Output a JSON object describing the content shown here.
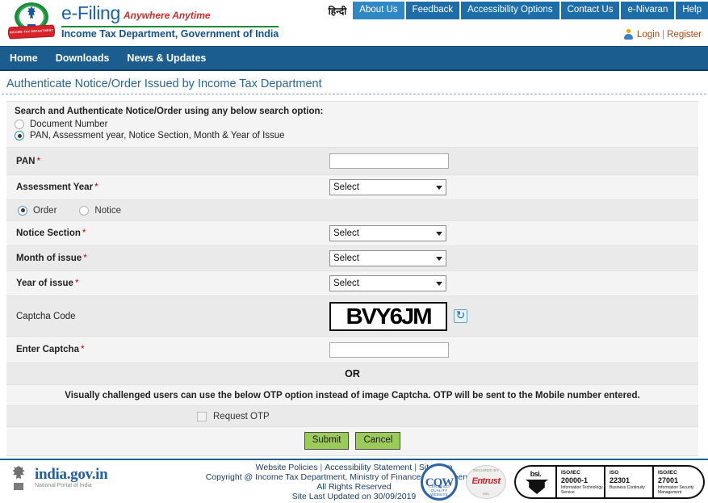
{
  "header": {
    "logo_alt": "income-tax-department-emblem",
    "emblem_ribbon": "INCOME TAX DEPARTMENT",
    "brand_main": "e-Filing",
    "brand_tagline": "Anywhere Anytime",
    "brand_sub": "Income Tax Department, Government of India",
    "hindi_label": "हिन्दी",
    "top_nav": [
      {
        "label": "About Us",
        "active": true
      },
      {
        "label": "Feedback",
        "active": false
      },
      {
        "label": "Accessibility Options",
        "active": false
      },
      {
        "label": "Contact Us",
        "active": false
      },
      {
        "label": "e-Nivaran",
        "active": false
      },
      {
        "label": "Help",
        "active": false
      }
    ],
    "login_label": "Login",
    "login_separator": "|",
    "register_label": "Register"
  },
  "main_nav": {
    "items": [
      {
        "label": "Home"
      },
      {
        "label": "Downloads"
      },
      {
        "label": "News & Updates"
      }
    ]
  },
  "page": {
    "title": "Authenticate Notice/Order Issued by Income Tax Department"
  },
  "search_options": {
    "heading": "Search and Authenticate Notice/Order using any below search option:",
    "option_document_number": "Document Number",
    "option_pan": "PAN, Assessment year, Notice Section, Month & Year of Issue",
    "selected": "pan"
  },
  "form": {
    "pan": {
      "label": "PAN",
      "required": "*",
      "value": "",
      "placeholder": ""
    },
    "assessment_year": {
      "label": "Assessment Year",
      "required": "*",
      "value": "Select"
    },
    "doc_type": {
      "order_label": "Order",
      "notice_label": "Notice",
      "selected": "order"
    },
    "notice_section": {
      "label": "Notice Section",
      "required": "*",
      "value": "Select"
    },
    "month_of_issue": {
      "label": "Month of issue",
      "required": "*",
      "value": "Select"
    },
    "year_of_issue": {
      "label": "Year of issue",
      "required": "*",
      "value": "Select"
    },
    "captcha_code": {
      "label": "Captcha Code",
      "value": "BVY6JM"
    },
    "enter_captcha": {
      "label": "Enter Captcha",
      "required": "*",
      "value": "",
      "placeholder": ""
    },
    "or_divider": "OR",
    "otp_note": "Visually challenged users can use the below OTP option instead of image Captcha. OTP will be sent to the Mobile number entered.",
    "request_otp_label": "Request OTP",
    "submit_label": "Submit",
    "cancel_label": "Cancel"
  },
  "footer": {
    "india_gov_title": "india.gov.in",
    "india_gov_sub": "National Portal of India",
    "links": [
      {
        "label": "Website Policies"
      },
      {
        "label": "Accessibility Statement"
      },
      {
        "label": "Site Map"
      }
    ],
    "separator": "|",
    "copyright": "Copyright @ Income Tax Department, Ministry of Finance,Government of India.",
    "rights": "All Rights Reserved",
    "last_updated": "Site Last Updated on 30/09/2019",
    "certs": {
      "cgw_text": "CQW",
      "cgw_arc": "CERTIFIED QUALITY WEBSITE",
      "entrust_top": "SECURED BY",
      "entrust_name": "Entrust",
      "entrust_bottom": "SSL",
      "bsi_label": "bsi.",
      "badges": [
        {
          "standard": "ISO/IEC",
          "number": "20000-1",
          "description": "Information Technology Service"
        },
        {
          "standard": "ISO",
          "number": "22301",
          "description": "Business Continuity"
        },
        {
          "standard": "ISO/IEC",
          "number": "27001",
          "description": "Information Security Management"
        }
      ]
    }
  },
  "colors": {
    "nav_blue": "#1b5d8e",
    "top_nav_blue": "#1d6ea8",
    "top_nav_active": "#2f87c4",
    "link_brown": "#b04a12",
    "title_blue": "#2a6596",
    "button_green": "#9ccb5a",
    "required_red": "#cc0000",
    "brand_blue": "#1a5fa8",
    "tagline_red": "#d62b2b"
  }
}
